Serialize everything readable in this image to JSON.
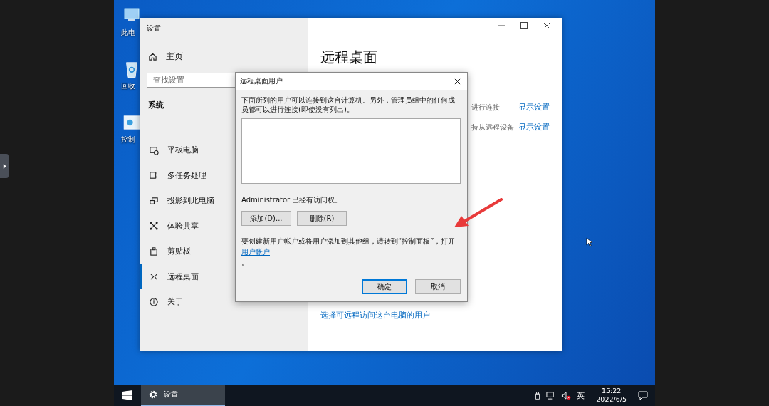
{
  "desktop_icons": [
    {
      "label": "此电"
    },
    {
      "label": "回收"
    },
    {
      "label": "控制"
    }
  ],
  "settings_window": {
    "title": "设置",
    "sidebar": {
      "home": "主页",
      "search": {
        "placeholder": "查找设置"
      },
      "section": "系统",
      "items": [
        {
          "label": "平板电脑",
          "selected": false
        },
        {
          "label": "多任务处理",
          "selected": false
        },
        {
          "label": "投影到此电脑",
          "selected": false
        },
        {
          "label": "体验共享",
          "selected": false
        },
        {
          "label": "剪贴板",
          "selected": false
        },
        {
          "label": "远程桌面",
          "selected": true
        },
        {
          "label": "关于",
          "selected": false
        }
      ]
    },
    "content": {
      "heading": "远程桌面",
      "rows": [
        {
          "text": "进行连接",
          "link": "显示设置"
        },
        {
          "text": "持从远程设备",
          "link": "显示设置"
        }
      ],
      "users_link": "选择可远程访问这台电脑的用户"
    }
  },
  "dialog": {
    "title": "远程桌面用户",
    "description": "下面所列的用户可以连接到这台计算机。另外，管理员组中的任何成员都可以进行连接(即使没有列出)。",
    "status": "Administrator 已经有访问权。",
    "buttons": [
      {
        "label": "添加(D)..."
      },
      {
        "label": "删除(R)"
      }
    ],
    "note": "要创建新用户帐户或将用户添加到其他组，请转到“控制面板”，打开",
    "note_link": "用户帐户",
    "note_end": "。",
    "footer_buttons": [
      {
        "label": "确定",
        "default": true
      },
      {
        "label": "取消",
        "default": false
      }
    ]
  },
  "taskbar": {
    "tasks": [
      {
        "label": "设置",
        "active": true
      }
    ],
    "ime": "英",
    "time": "15:22",
    "date": "2022/6/5"
  }
}
